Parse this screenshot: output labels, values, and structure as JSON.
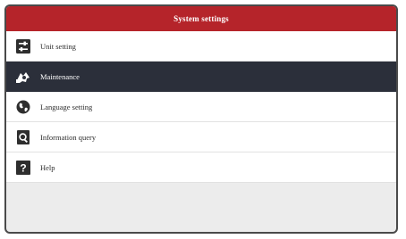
{
  "header": {
    "title": "System settings"
  },
  "menu": {
    "items": [
      {
        "label": "Unit setting",
        "icon": "sliders-icon",
        "active": false
      },
      {
        "label": "Maintenance",
        "icon": "maintenance-icon",
        "active": true
      },
      {
        "label": "Language setting",
        "icon": "globe-icon",
        "active": false
      },
      {
        "label": "Information query",
        "icon": "search-document-icon",
        "active": false
      },
      {
        "label": "Help",
        "icon": "question-icon",
        "active": false
      }
    ]
  },
  "colors": {
    "header_bg": "#b5242a",
    "active_row_bg": "#2b2f3a",
    "page_bg": "#ececec"
  }
}
